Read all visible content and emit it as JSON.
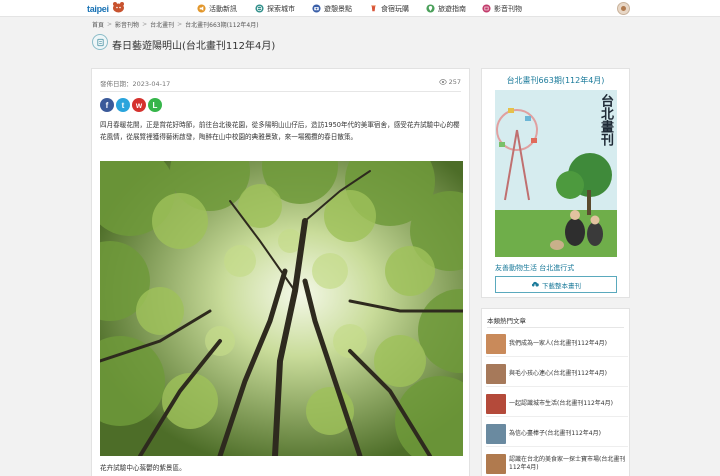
{
  "nav": {
    "logo": "taipei",
    "items": [
      {
        "label": "活動新訊",
        "icon": "megaphone-icon",
        "color": "#e2962a"
      },
      {
        "label": "探索城市",
        "icon": "globe-icon",
        "color": "#2f8f8a"
      },
      {
        "label": "遊憩景點",
        "icon": "camera-icon",
        "color": "#3a5fa8"
      },
      {
        "label": "食宿玩購",
        "icon": "drink-icon",
        "color": "#d8553a"
      },
      {
        "label": "旅遊指南",
        "icon": "map-pin-icon",
        "color": "#4aa05a"
      },
      {
        "label": "影音刊物",
        "icon": "film-icon",
        "color": "#c23b6b"
      }
    ]
  },
  "breadcrumb": [
    "首頁",
    "影音刊物",
    "台北畫刊",
    "台北畫刊663期(112年4月)"
  ],
  "page_title": "春日藝遊陽明山(台北畫刊112年4月)",
  "article": {
    "publish_date": "發佈日期：2023-04-17",
    "views": "257",
    "intro": "四月春暖花開，正是賞花好時節，前往台北後花園，從多陽明山山仔后，造訪1950年代的美軍宿舍，感受花卉試驗中心的櫻花風情，從展覽裡獲得藝術啟發，陶醉在山中校園的典雅景致，來一場獨攬的春日散策。",
    "caption": "花卉試驗中心蓊鬱的紫景區。"
  },
  "magazine": {
    "title": "台北畫刊663期(112年4月)",
    "cover_title": "台北畫刊",
    "tagline": "友善動物生活 台北進行式",
    "download_label": "下載整本畫刊"
  },
  "hot": {
    "title": "本類熱門文章",
    "items": [
      {
        "label": "我們成為一家人(台北畫刊112年4月)",
        "color": "#c98a5a"
      },
      {
        "label": "與毛小孩心連心(台北畫刊112年4月)",
        "color": "#a6795a"
      },
      {
        "label": "一起認識城市生活(台北畫刊112年4月)",
        "color": "#b44a3a"
      },
      {
        "label": "為信心盡棒子(台北畫刊112年4月)",
        "color": "#6a8aa0"
      },
      {
        "label": "認識在台北的美食家一探士寶市場(台北畫刊112年4月)",
        "color": "#b07a4e"
      }
    ]
  }
}
